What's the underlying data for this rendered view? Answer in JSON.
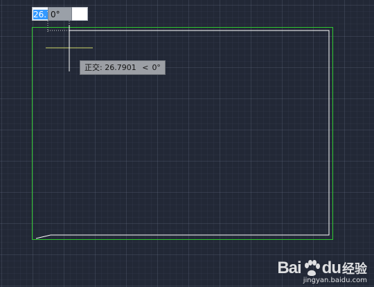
{
  "dynamic_input": {
    "length_value": "26.7901",
    "angle_value": "0°"
  },
  "tooltip": {
    "mode_label": "正交:",
    "distance": "26.7901",
    "angle_symbol": "<",
    "angle": "0°"
  },
  "watermark": {
    "logo_text_1": "Bai",
    "logo_text_2": "du",
    "brand_cn": "经验",
    "url": "jingyan.baidu.com"
  },
  "colors": {
    "background": "#222836",
    "outer_rectangle": "#2ec82e",
    "inner_polyline": "#ffffff",
    "crosshair_horizontal": "#cfd96a",
    "crosshair_vertical": "#ffffff",
    "selection": "#3399ff"
  },
  "icons": [
    "paw-icon",
    "crosshair-cursor"
  ]
}
